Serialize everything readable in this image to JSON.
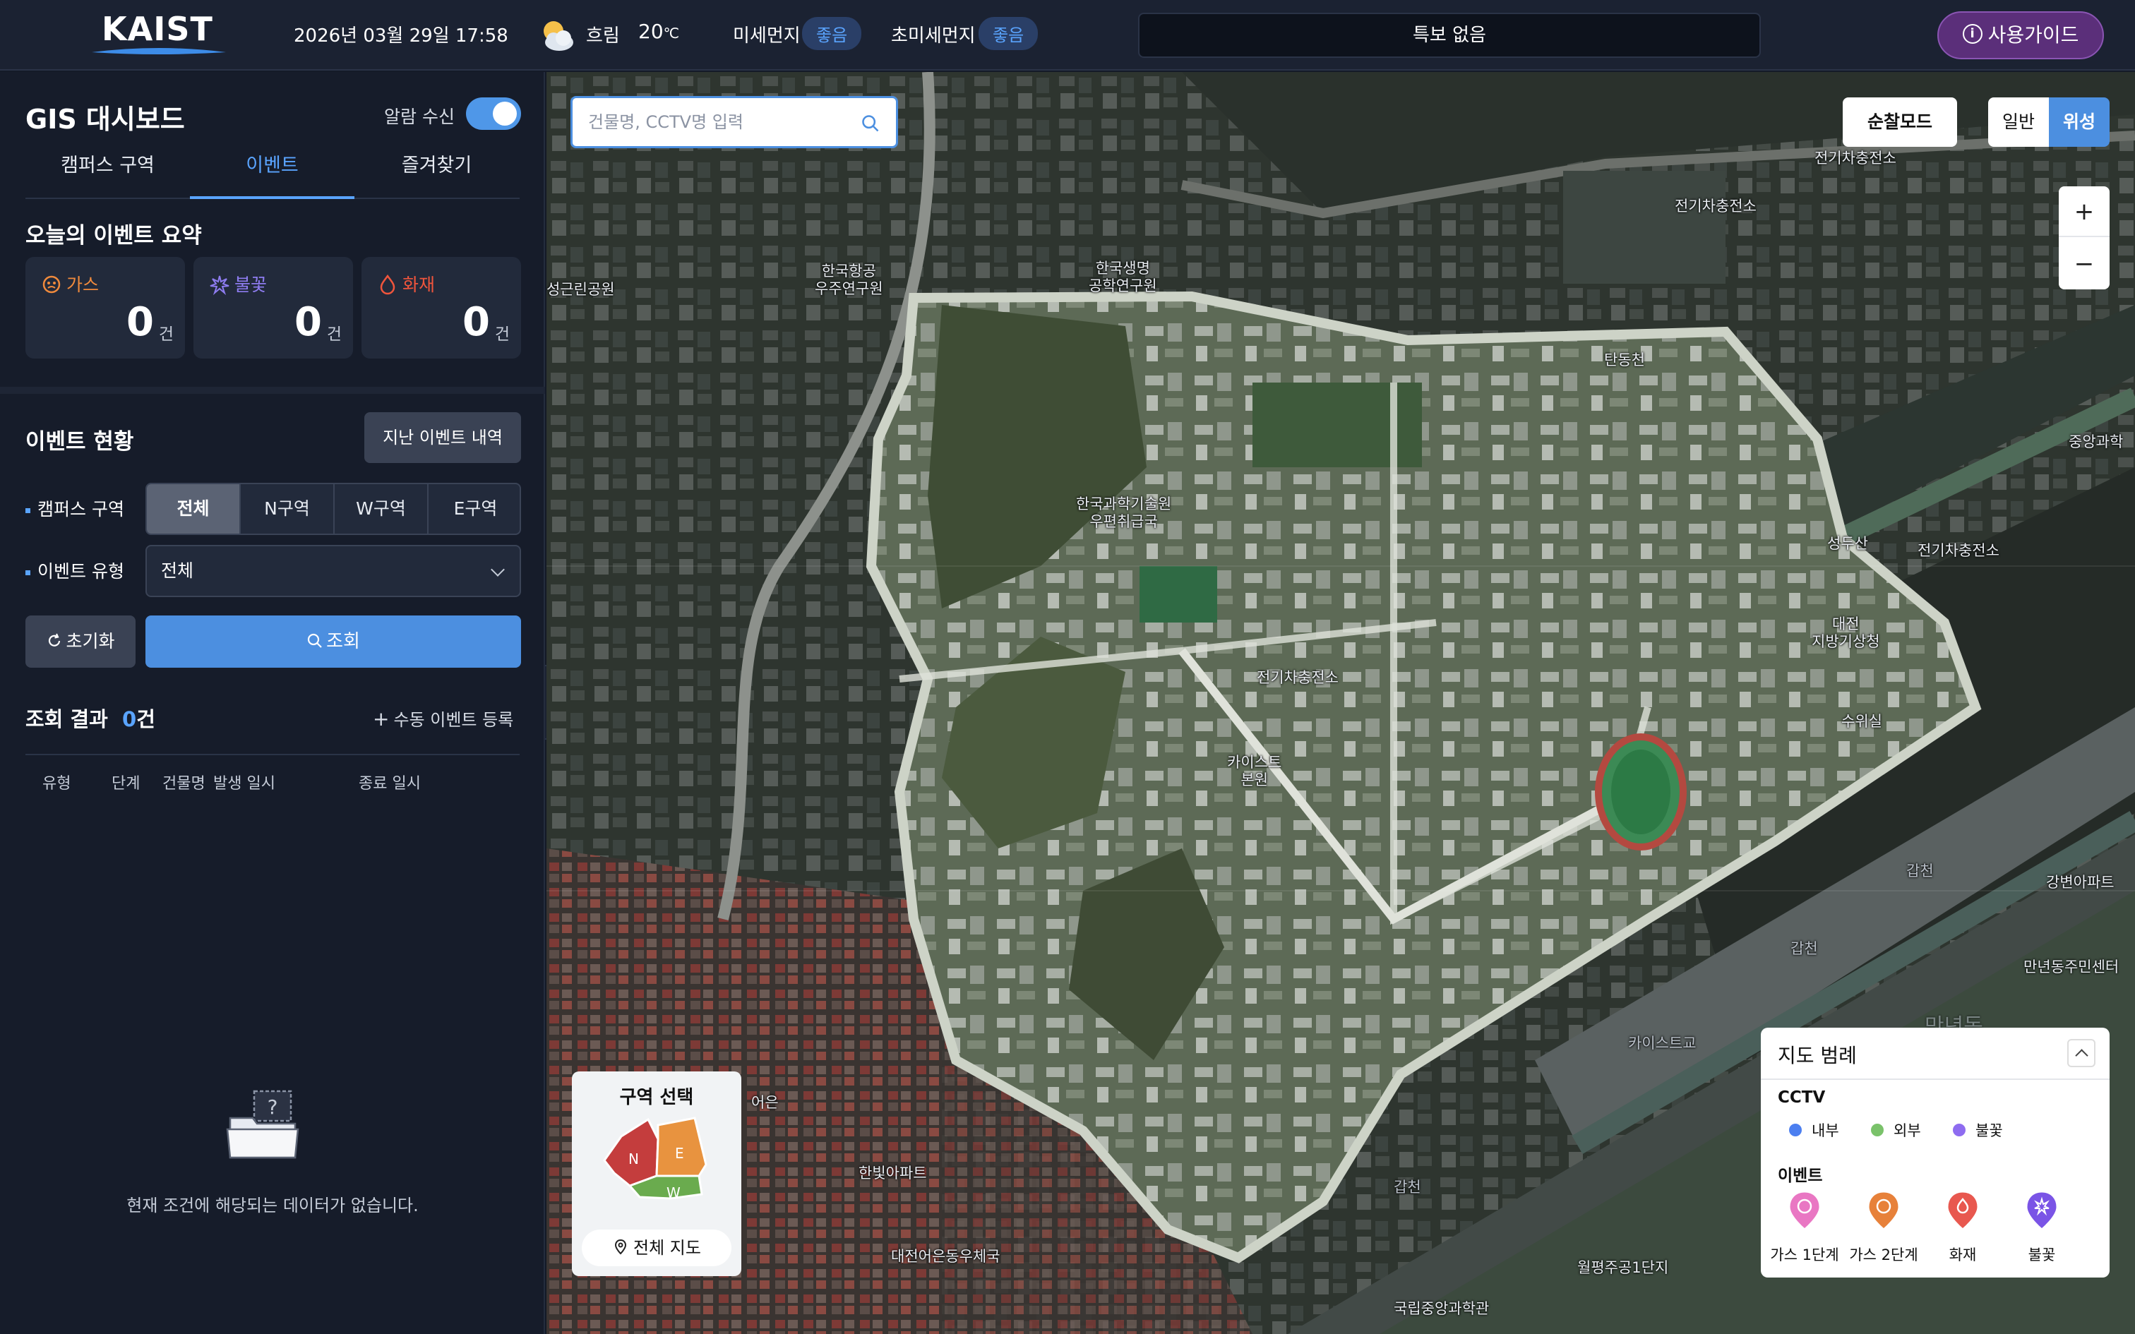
{
  "header": {
    "logo": "KAIST",
    "datetime": "2026년 03월 29일 17:58",
    "weather": "흐림",
    "temperature": "20",
    "temp_unit": "℃",
    "fine_dust_label": "미세먼지",
    "fine_dust_value": "좋음",
    "ultra_dust_label": "초미세먼지",
    "ultra_dust_value": "좋음",
    "notice": "특보 없음",
    "guide_label": "사용가이드"
  },
  "sidebar": {
    "title": "GIS 대시보드",
    "alarm_label": "알람 수신",
    "alarm_on": true,
    "tabs": [
      "캠퍼스 구역",
      "이벤트",
      "즐겨찾기"
    ],
    "active_tab": "이벤트",
    "summary": {
      "title": "오늘의 이벤트 요약",
      "unit": "건",
      "cards": [
        {
          "label": "가스",
          "count": "0",
          "color": "#f08a3c"
        },
        {
          "label": "불꽃",
          "count": "0",
          "color": "#8e7cf0"
        },
        {
          "label": "화재",
          "count": "0",
          "color": "#f0553c"
        }
      ]
    },
    "events": {
      "title": "이벤트 현황",
      "past_button": "지난 이벤트 내역",
      "zone_label": "캠퍼스 구역",
      "zones": [
        "전체",
        "N구역",
        "W구역",
        "E구역"
      ],
      "active_zone": "전체",
      "type_label": "이벤트 유형",
      "type_value": "전체",
      "reset_button": "초기화",
      "search_button": "조회"
    },
    "results": {
      "title": "조회 결과",
      "count": "0",
      "unit": "건",
      "manual_button": "수동 이벤트 등록",
      "columns": [
        "유형",
        "단계",
        "건물명",
        "발생 일시",
        "종료 일시"
      ],
      "empty_message": "현재 조건에 해당되는 데이터가 없습니다."
    }
  },
  "map": {
    "search_placeholder": "건물명, CCTV명 입력",
    "patrol_button": "순찰모드",
    "map_types": [
      "일반",
      "위성"
    ],
    "active_map_type": "위성",
    "zoom_in": "+",
    "zoom_out": "−",
    "zone_select": {
      "title": "구역 선택",
      "zones": [
        "N",
        "E",
        "W"
      ],
      "full_button": "전체 지도"
    },
    "legend": {
      "title": "지도 범례",
      "cctv_title": "CCTV",
      "cctv_items": [
        {
          "label": "내부",
          "color": "#4c7ff0"
        },
        {
          "label": "외부",
          "color": "#7ac26a"
        },
        {
          "label": "불꽃",
          "color": "#8e6cf0"
        }
      ],
      "event_title": "이벤트",
      "event_items": [
        {
          "label": "가스 1단계",
          "color": "#e977c3"
        },
        {
          "label": "가스 2단계",
          "color": "#e7813a"
        },
        {
          "label": "화재",
          "color": "#e8584f"
        },
        {
          "label": "불꽃",
          "color": "#7a54e6"
        }
      ]
    },
    "labels": [
      "한국항공\n우주연구원",
      "한국생명\n공학연구원",
      "전기차충전소",
      "전기차충전소",
      "탄동천",
      "한국과학기술원\n우편취급국",
      "전기차충전소",
      "카이스트\n본원",
      "성두산",
      "전기차충전소",
      "대전\n지방기상청",
      "수위실",
      "갑천",
      "한빛아파트",
      "대전어은동우체국",
      "카이스트교",
      "만년동주민센터",
      "갑천",
      "갑천",
      "강변아파트",
      "만년동",
      "중앙과학",
      "월평주공1단지",
      "국립중앙과학관",
      "성근린공원",
      "어은"
    ]
  }
}
